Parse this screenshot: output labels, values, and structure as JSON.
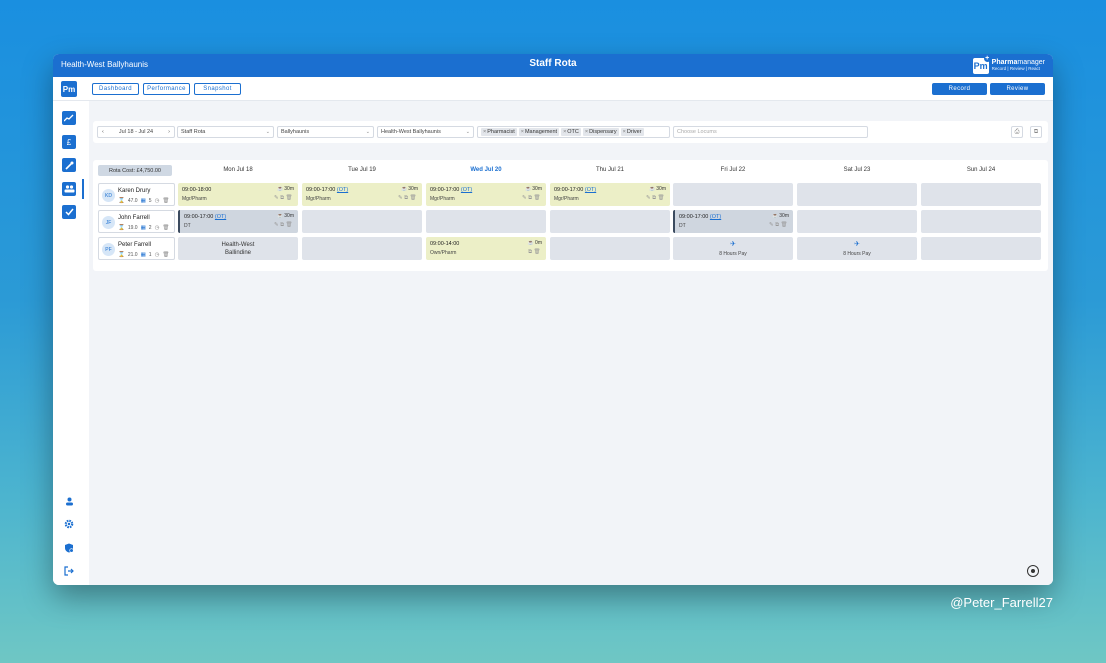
{
  "window": {
    "pharmacy": "Health-West Ballyhaunis",
    "title": "Staff Rota",
    "brand_logo": "Pm",
    "brand_name_bold": "Pharma",
    "brand_name_rest": "manager",
    "brand_tagline": "Record | Review | React"
  },
  "toolbar": {
    "logo": "Pm",
    "nav": [
      "Dashboard",
      "Performance",
      "Snapshot"
    ],
    "record_label": "Record",
    "review_label": "Review"
  },
  "sidebar": {
    "top_icons": [
      "chart-icon",
      "euro-icon",
      "tools-icon",
      "team-icon",
      "checkmark-icon"
    ],
    "bottom_icons": [
      "user-icon",
      "settings-icon",
      "security-icon",
      "logout-icon"
    ],
    "euro_glyph": "£"
  },
  "filters": {
    "date_range": "Jul 18 - Jul 24",
    "rota": "Staff Rota",
    "location": "Ballyhaunis",
    "store": "Health-West Ballyhaunis",
    "roles": [
      "Pharmacist",
      "Management",
      "OTC",
      "Dispensary",
      "Driver"
    ],
    "locums_placeholder": "Choose Locums"
  },
  "rota": {
    "cost": "Rota Cost: £4,750.00",
    "days": [
      "Mon Jul 18",
      "Tue Jul 19",
      "Wed Jul 20",
      "Thu Jul 21",
      "Fri Jul 22",
      "Sat Jul 23",
      "Sun Jul 24"
    ],
    "staff": [
      {
        "initials": "KD",
        "name": "Karen Drury",
        "hours": "47.0",
        "days": "5"
      },
      {
        "initials": "JF",
        "name": "John Farrell",
        "hours": "19.0",
        "days": "2"
      },
      {
        "initials": "PF",
        "name": "Peter Farrell",
        "hours": "21.0",
        "days": "1"
      }
    ],
    "karen": {
      "mon": {
        "time": "09:00-18:00",
        "role": "Mgr/Pharm",
        "break": "30m"
      },
      "tue": {
        "time": "09:00-17:00",
        "ot": "(OT)",
        "role": "Mgr/Pharm",
        "break": "30m"
      },
      "wed": {
        "time": "09:00-17:00",
        "ot": "(OT)",
        "role": "Mgr/Pharm",
        "break": "30m"
      },
      "thu": {
        "time": "09:00-17:00",
        "ot": "(OT)",
        "role": "Mgr/Pharm",
        "break": "30m"
      }
    },
    "john": {
      "mon": {
        "time": "09:00-17:00",
        "ot": "(OT)",
        "role": "DT",
        "break": "30m"
      },
      "fri": {
        "time": "09:00-17:00",
        "ot": "(OT)",
        "role": "DT",
        "break": "30m"
      }
    },
    "peter": {
      "mon_line1": "Health-West",
      "mon_line2": "Ballindine",
      "wed": {
        "time": "09:00-14:00",
        "role": "Own/Pharm",
        "break": "0m"
      },
      "fri_leave": "8 Hours Pay",
      "sat_leave": "8 Hours Pay"
    }
  },
  "footer": {
    "watermark": "@Peter_Farrell27"
  }
}
